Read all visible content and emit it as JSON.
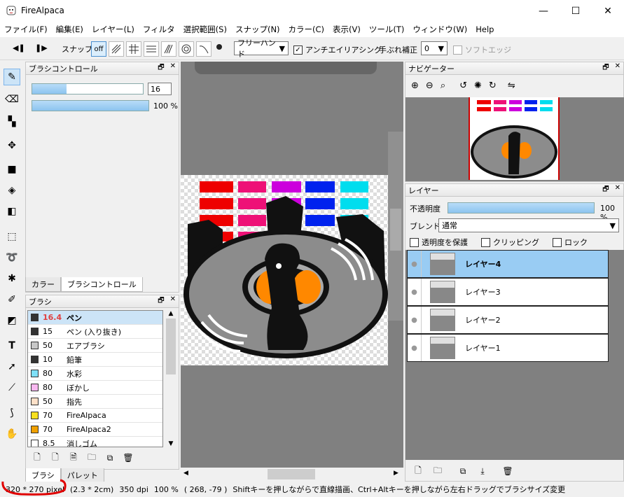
{
  "window": {
    "title": "FireAlpaca",
    "minimize": "—",
    "maximize": "☐",
    "close": "✕"
  },
  "menu": [
    "ファイル(F)",
    "編集(E)",
    "レイヤー(L)",
    "フィルタ",
    "選択範囲(S)",
    "スナップ(N)",
    "カラー(C)",
    "表示(V)",
    "ツール(T)",
    "ウィンドウ(W)",
    "Help"
  ],
  "toolbar": {
    "snap_label": "スナップ",
    "snap_off": "off",
    "mode": "フリーハンド",
    "antialias": "アンチエイリアシング",
    "stabilizer_label": "手ぶれ補正",
    "stabilizer_value": "0",
    "soft_edge": "ソフトエッジ"
  },
  "brush_control": {
    "title": "ブラシコントロール",
    "size_value": "16",
    "size_fraction": 0.31,
    "opacity_text": "100 %",
    "opacity_fraction": 1.0
  },
  "tabs_top": {
    "color": "カラー",
    "brush_control": "ブラシコントロール"
  },
  "brush_panel": {
    "title": "ブラシ",
    "items": [
      {
        "size": "16.4",
        "name": "ペン",
        "color": "#333333",
        "selected": true
      },
      {
        "size": "15",
        "name": "ペン (入り抜き)",
        "color": "#333333"
      },
      {
        "size": "50",
        "name": "エアブラシ",
        "color": "#c8c8c8"
      },
      {
        "size": "10",
        "name": "鉛筆",
        "color": "#333333"
      },
      {
        "size": "80",
        "name": "水彩",
        "color": "#7fe0f8"
      },
      {
        "size": "80",
        "name": "ぼかし",
        "color": "#f8b8f0"
      },
      {
        "size": "50",
        "name": "指先",
        "color": "#fde0c8"
      },
      {
        "size": "70",
        "name": "FireAlpaca",
        "color": "#f8e020"
      },
      {
        "size": "70",
        "name": "FireAlpaca2",
        "color": "#f0a000"
      },
      {
        "size": "8.5",
        "name": "消しゴム",
        "color": "#ffffff"
      }
    ]
  },
  "tabs_bottom": {
    "brush": "ブラシ",
    "palette": "パレット"
  },
  "navigator": {
    "title": "ナビゲーター"
  },
  "layers": {
    "title": "レイヤー",
    "opacity_label": "不透明度",
    "opacity_text": "100 %",
    "opacity_fraction": 1.0,
    "blend_label": "ブレンド",
    "blend_value": "通常",
    "protect_alpha": "透明度を保護",
    "clipping": "クリッピング",
    "lock": "ロック",
    "items": [
      {
        "name": "レイヤー4",
        "selected": true
      },
      {
        "name": "レイヤー3"
      },
      {
        "name": "レイヤー2"
      },
      {
        "name": "レイヤー1"
      }
    ]
  },
  "status": {
    "size": "320 * 270 pixel",
    "cm": "(2.3 * 2cm)",
    "dpi": "350 dpi",
    "zoom": "100 %",
    "coords": "( 268, -79 )",
    "hint": "Shiftキーを押しながらで直線描画、Ctrl+Altキーを押しながら左右ドラッグでブラシサイズ変更"
  },
  "colors": {
    "accent": "#99ccf3",
    "canvas_bg": "#808080",
    "annotation": "#e00000"
  }
}
